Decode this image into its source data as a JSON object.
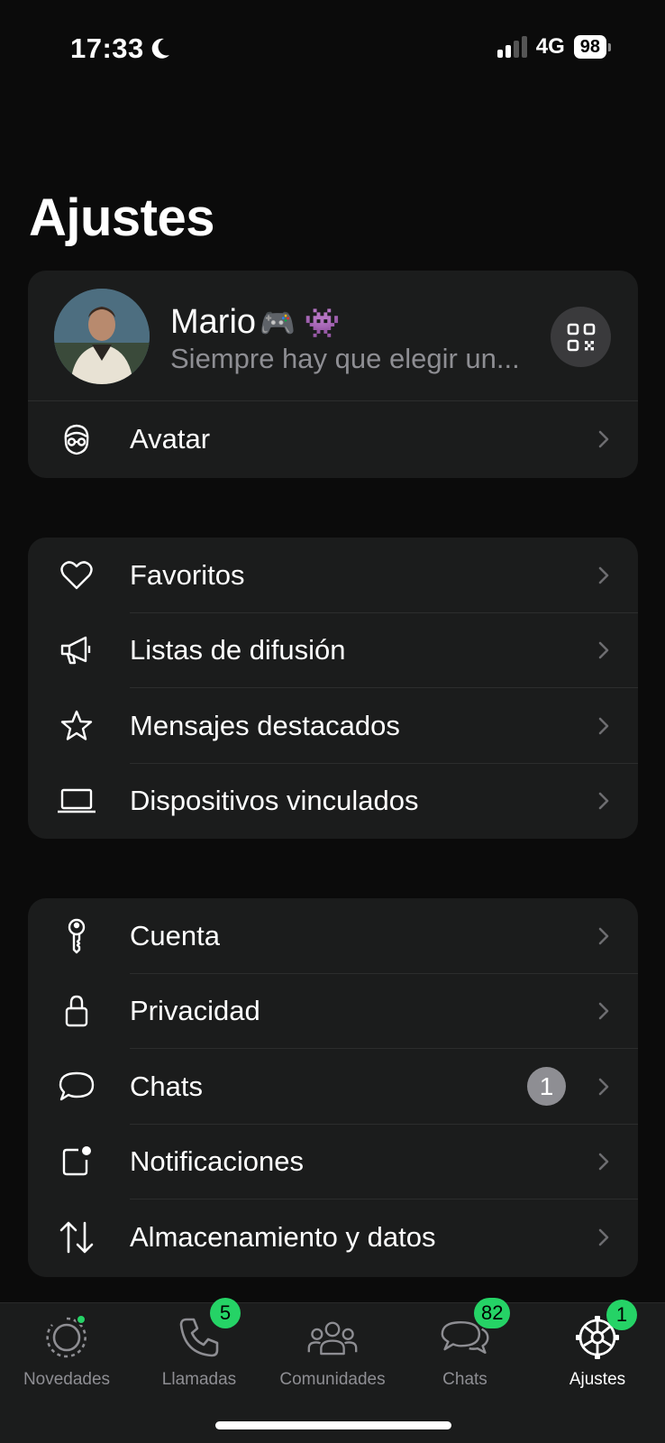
{
  "status_bar": {
    "time": "17:33",
    "network": "4G",
    "battery": "98"
  },
  "page": {
    "title": "Ajustes"
  },
  "profile": {
    "name": "Mario",
    "name_emoji_1": "🎮",
    "name_emoji_2": "👾",
    "status": "Siempre hay que elegir un..."
  },
  "profile_section": [
    {
      "label": "Avatar",
      "icon": "avatar-icon"
    }
  ],
  "group_one": [
    {
      "label": "Favoritos",
      "icon": "heart-icon"
    },
    {
      "label": "Listas de difusión",
      "icon": "megaphone-icon"
    },
    {
      "label": "Mensajes destacados",
      "icon": "star-icon"
    },
    {
      "label": "Dispositivos vinculados",
      "icon": "laptop-icon"
    }
  ],
  "group_two": [
    {
      "label": "Cuenta",
      "icon": "key-icon"
    },
    {
      "label": "Privacidad",
      "icon": "lock-icon"
    },
    {
      "label": "Chats",
      "icon": "chat-bubble-icon",
      "badge": "1"
    },
    {
      "label": "Notificaciones",
      "icon": "notification-icon"
    },
    {
      "label": "Almacenamiento y datos",
      "icon": "storage-arrows-icon"
    }
  ],
  "tabs": [
    {
      "label": "Novedades",
      "icon": "updates-icon",
      "active": false
    },
    {
      "label": "Llamadas",
      "icon": "phone-icon",
      "badge": "5",
      "active": false
    },
    {
      "label": "Comunidades",
      "icon": "communities-icon",
      "active": false
    },
    {
      "label": "Chats",
      "icon": "chats-icon",
      "badge": "82",
      "active": false
    },
    {
      "label": "Ajustes",
      "icon": "settings-gear-icon",
      "badge": "1",
      "active": true
    }
  ],
  "colors": {
    "accent": "#25d366",
    "background": "#0b0b0b",
    "card": "#1b1c1c",
    "secondary_text": "#8e8e93"
  }
}
